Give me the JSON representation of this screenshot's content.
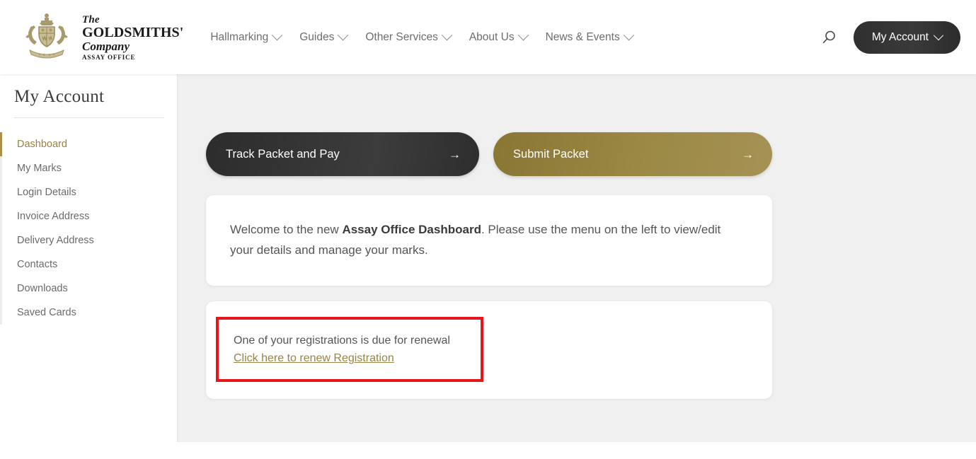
{
  "header": {
    "brand": {
      "the": "The",
      "name": "GOLDSMITHS'",
      "company": "Company",
      "sub": "ASSAY OFFICE",
      "crest_icon": "goldsmiths-crest-icon"
    },
    "nav": [
      {
        "label": "Hallmarking"
      },
      {
        "label": "Guides"
      },
      {
        "label": "Other Services"
      },
      {
        "label": "About Us"
      },
      {
        "label": "News & Events"
      }
    ],
    "search_icon": "search-icon",
    "account_label": "My Account"
  },
  "sidebar": {
    "title": "My Account",
    "items": [
      {
        "label": "Dashboard",
        "active": true
      },
      {
        "label": "My Marks",
        "active": false
      },
      {
        "label": "Login Details",
        "active": false
      },
      {
        "label": "Invoice Address",
        "active": false
      },
      {
        "label": "Delivery Address",
        "active": false
      },
      {
        "label": "Contacts",
        "active": false
      },
      {
        "label": "Downloads",
        "active": false
      },
      {
        "label": "Saved Cards",
        "active": false
      }
    ]
  },
  "main": {
    "actions": [
      {
        "label": "Track Packet and Pay",
        "arrow": "→",
        "style": "dark"
      },
      {
        "label": "Submit Packet",
        "arrow": "→",
        "style": "gold"
      }
    ],
    "welcome": {
      "part1": "Welcome to the new ",
      "emphasis": "Assay Office Dashboard",
      "part2": ". Please use the menu on the left to view/edit your details and manage your marks."
    },
    "renewal": {
      "message": "One of your registrations is due for renewal",
      "link": "Click here to renew Registration"
    }
  },
  "colors": {
    "gold": "#9a8346",
    "gold_button": "#8a7634",
    "dark_button": "#333333",
    "alert_border": "#e8161a",
    "content_bg": "#f0f0f0"
  }
}
